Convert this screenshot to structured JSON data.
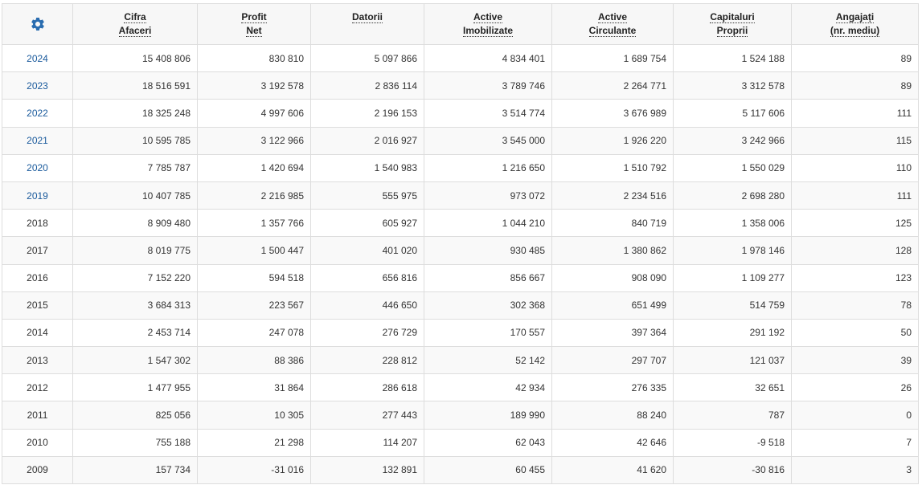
{
  "header": {
    "settings_icon": "gear-icon",
    "columns": [
      {
        "l1": "Cifra",
        "l2": "Afaceri"
      },
      {
        "l1": "Profit",
        "l2": "Net"
      },
      {
        "l1": "Datorii",
        "l2": ""
      },
      {
        "l1": "Active",
        "l2": "Imobilizate"
      },
      {
        "l1": "Active",
        "l2": "Circulante"
      },
      {
        "l1": "Capitaluri",
        "l2": "Proprii"
      },
      {
        "l1": "Angajați",
        "l2": "(nr. mediu)"
      }
    ]
  },
  "colors": {
    "link": "#1a5a9c",
    "gear": "#2a6db0",
    "border": "#dddddd"
  },
  "rows": [
    {
      "year": "2024",
      "linked": true,
      "values": [
        "15 408 806",
        "830 810",
        "5 097 866",
        "4 834 401",
        "1 689 754",
        "1 524 188",
        "89"
      ]
    },
    {
      "year": "2023",
      "linked": true,
      "values": [
        "18 516 591",
        "3 192 578",
        "2 836 114",
        "3 789 746",
        "2 264 771",
        "3 312 578",
        "89"
      ]
    },
    {
      "year": "2022",
      "linked": true,
      "values": [
        "18 325 248",
        "4 997 606",
        "2 196 153",
        "3 514 774",
        "3 676 989",
        "5 117 606",
        "111"
      ]
    },
    {
      "year": "2021",
      "linked": true,
      "values": [
        "10 595 785",
        "3 122 966",
        "2 016 927",
        "3 545 000",
        "1 926 220",
        "3 242 966",
        "115"
      ]
    },
    {
      "year": "2020",
      "linked": true,
      "values": [
        "7 785 787",
        "1 420 694",
        "1 540 983",
        "1 216 650",
        "1 510 792",
        "1 550 029",
        "110"
      ]
    },
    {
      "year": "2019",
      "linked": true,
      "values": [
        "10 407 785",
        "2 216 985",
        "555 975",
        "973 072",
        "2 234 516",
        "2 698 280",
        "111"
      ]
    },
    {
      "year": "2018",
      "linked": false,
      "values": [
        "8 909 480",
        "1 357 766",
        "605 927",
        "1 044 210",
        "840 719",
        "1 358 006",
        "125"
      ]
    },
    {
      "year": "2017",
      "linked": false,
      "values": [
        "8 019 775",
        "1 500 447",
        "401 020",
        "930 485",
        "1 380 862",
        "1 978 146",
        "128"
      ]
    },
    {
      "year": "2016",
      "linked": false,
      "values": [
        "7 152 220",
        "594 518",
        "656 816",
        "856 667",
        "908 090",
        "1 109 277",
        "123"
      ]
    },
    {
      "year": "2015",
      "linked": false,
      "values": [
        "3 684 313",
        "223 567",
        "446 650",
        "302 368",
        "651 499",
        "514 759",
        "78"
      ]
    },
    {
      "year": "2014",
      "linked": false,
      "values": [
        "2 453 714",
        "247 078",
        "276 729",
        "170 557",
        "397 364",
        "291 192",
        "50"
      ]
    },
    {
      "year": "2013",
      "linked": false,
      "values": [
        "1 547 302",
        "88 386",
        "228 812",
        "52 142",
        "297 707",
        "121 037",
        "39"
      ]
    },
    {
      "year": "2012",
      "linked": false,
      "values": [
        "1 477 955",
        "31 864",
        "286 618",
        "42 934",
        "276 335",
        "32 651",
        "26"
      ]
    },
    {
      "year": "2011",
      "linked": false,
      "values": [
        "825 056",
        "10 305",
        "277 443",
        "189 990",
        "88 240",
        "787",
        "0"
      ]
    },
    {
      "year": "2010",
      "linked": false,
      "values": [
        "755 188",
        "21 298",
        "114 207",
        "62 043",
        "42 646",
        "-9 518",
        "7"
      ]
    },
    {
      "year": "2009",
      "linked": false,
      "values": [
        "157 734",
        "-31 016",
        "132 891",
        "60 455",
        "41 620",
        "-30 816",
        "3"
      ]
    }
  ]
}
